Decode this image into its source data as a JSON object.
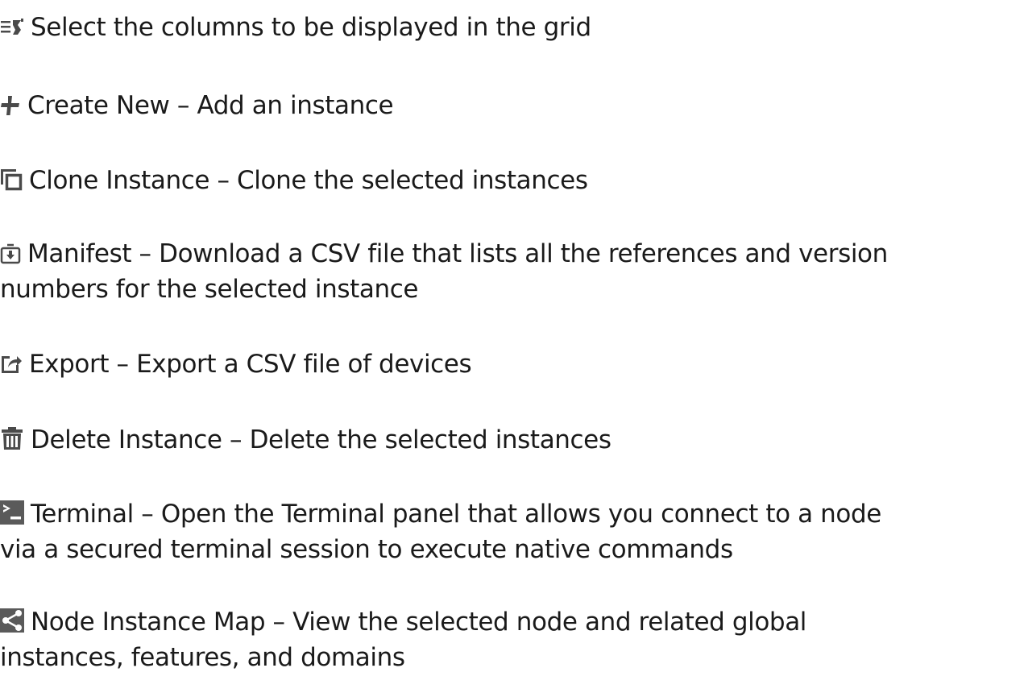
{
  "items": [
    {
      "icon": "column-chooser-icon",
      "text": "Select the columns to be displayed in the grid"
    },
    {
      "icon": "plus-icon",
      "text": "Create New – Add an instance"
    },
    {
      "icon": "clone-icon",
      "text": "Clone Instance – Clone the selected instances"
    },
    {
      "icon": "download-box-icon",
      "text": "Manifest – Download a CSV file that lists all the references and version",
      "text2": "numbers for the selected instance"
    },
    {
      "icon": "export-icon",
      "text": "Export – Export a CSV file of devices"
    },
    {
      "icon": "trash-icon",
      "text": "Delete Instance – Delete the selected instances"
    },
    {
      "icon": "terminal-icon",
      "text": "Terminal – Open the Terminal panel that allows you connect to a node",
      "text2": "via a secured terminal session to execute native commands"
    },
    {
      "icon": "share-node-icon",
      "text": "Node Instance Map – View the selected node and related global",
      "text2": "instances, features, and domains"
    }
  ],
  "colors": {
    "text": "#1a1a1a",
    "icon": "#4a4a4a",
    "icon_dark_bg": "#5a5a5a"
  }
}
